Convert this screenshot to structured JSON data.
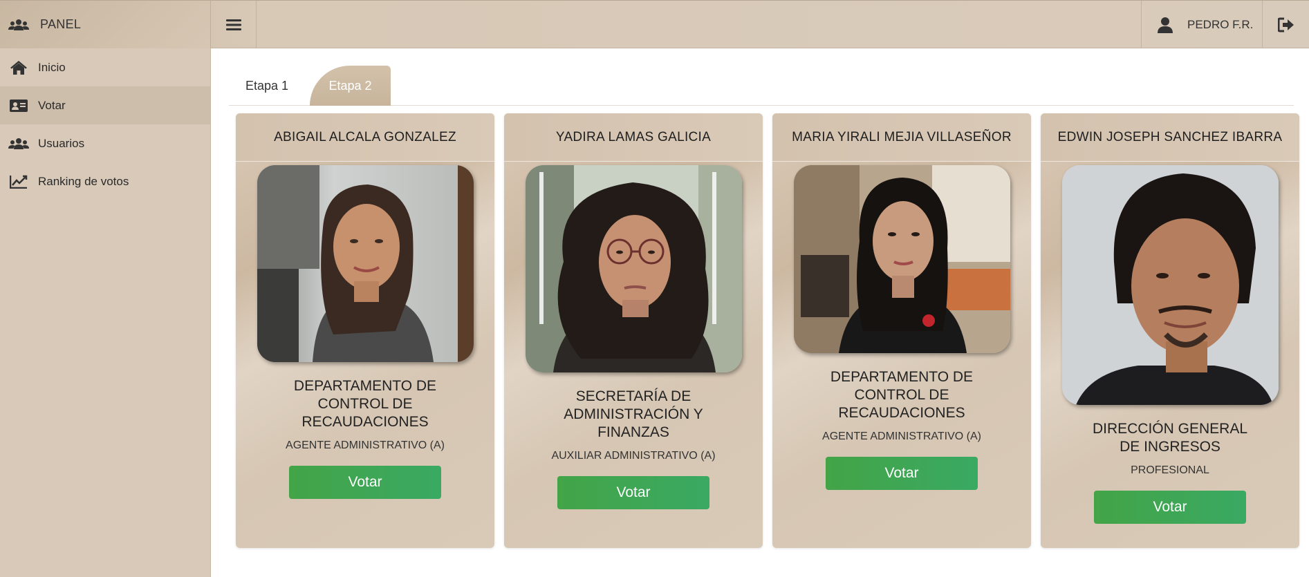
{
  "header": {
    "brand_label": "PANEL",
    "user_name": "PEDRO F.R."
  },
  "sidebar": {
    "items": [
      {
        "label": "Inicio",
        "icon": "home-icon"
      },
      {
        "label": "Votar",
        "icon": "id-card-icon",
        "active": true
      },
      {
        "label": "Usuarios",
        "icon": "users-icon"
      },
      {
        "label": "Ranking de votos",
        "icon": "chart-line-icon"
      }
    ]
  },
  "tabs": [
    {
      "label": "Etapa 1"
    },
    {
      "label": "Etapa 2",
      "active": true
    }
  ],
  "candidates": [
    {
      "name": "ABIGAIL ALCALA GONZALEZ",
      "department": "DEPARTAMENTO DE CONTROL DE RECAUDACIONES",
      "role": "AGENTE ADMINISTRATIVO (A)",
      "vote_label": "Votar"
    },
    {
      "name": "YADIRA LAMAS GALICIA",
      "department": "SECRETARÍA DE ADMINISTRACIÓN Y FINANZAS",
      "role": "AUXILIAR ADMINISTRATIVO (A)",
      "vote_label": "Votar"
    },
    {
      "name": "MARIA YIRALI MEJIA VILLASEÑOR",
      "department": "DEPARTAMENTO DE CONTROL DE RECAUDACIONES",
      "role": "AGENTE ADMINISTRATIVO (A)",
      "vote_label": "Votar"
    },
    {
      "name": "EDWIN JOSEPH SANCHEZ IBARRA",
      "department": "DIRECCIÓN GENERAL DE INGRESOS",
      "role": "PROFESIONAL",
      "vote_label": "Votar"
    }
  ],
  "colors": {
    "accent_tan": "#d3c1aa",
    "vote_green": "#43a447"
  }
}
